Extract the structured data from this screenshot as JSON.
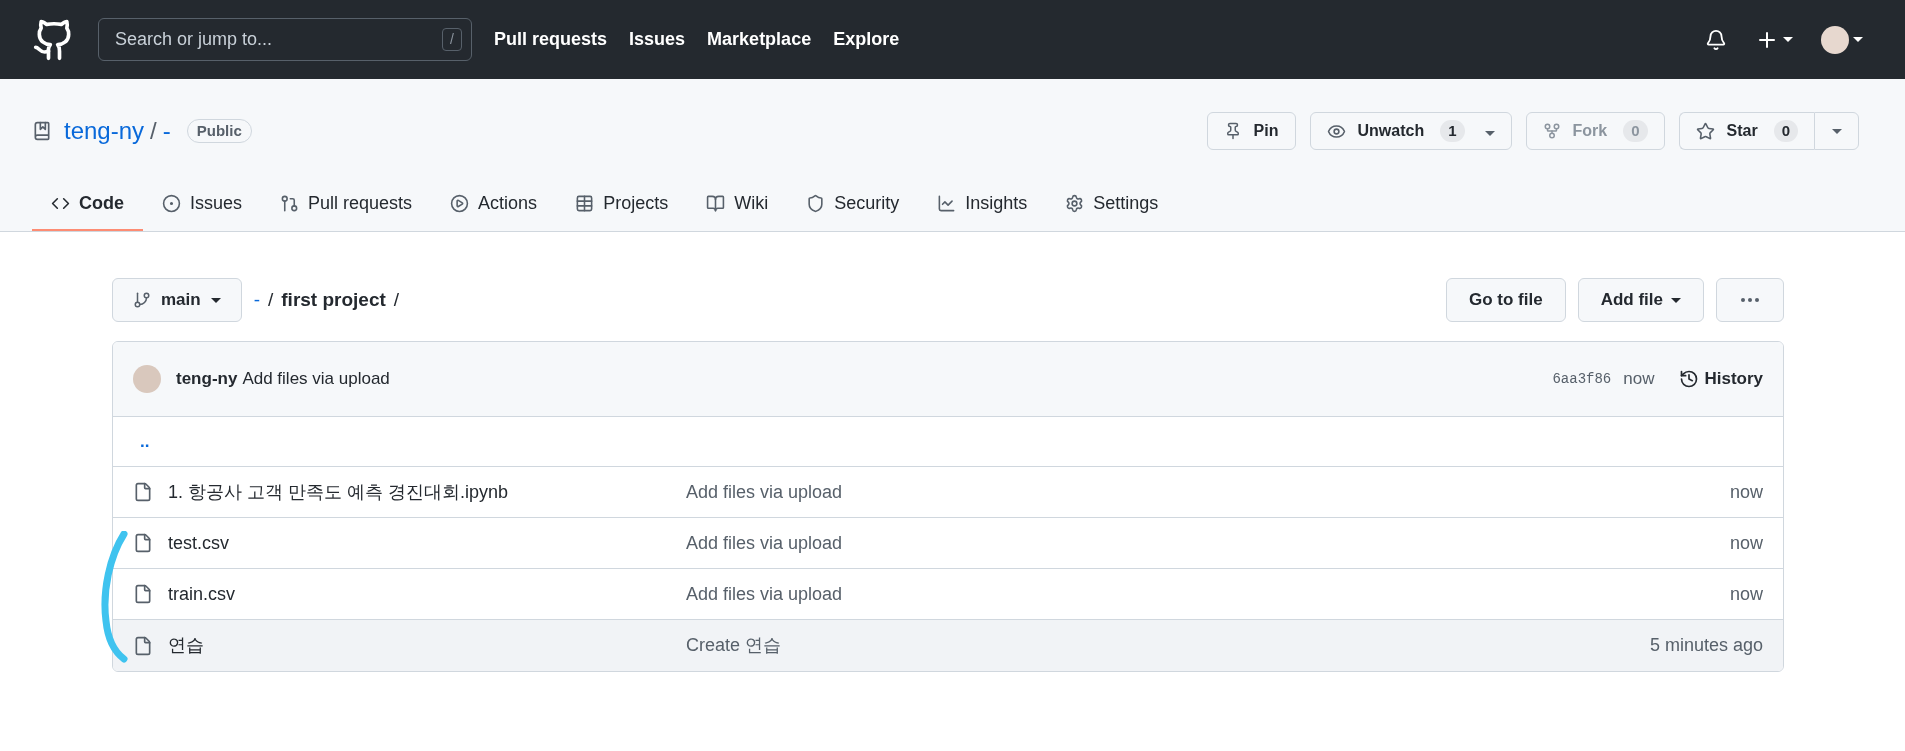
{
  "nav": {
    "search_placeholder": "Search or jump to...",
    "search_key": "/",
    "links": [
      "Pull requests",
      "Issues",
      "Marketplace",
      "Explore"
    ]
  },
  "repo": {
    "owner": "teng-ny",
    "separator": "/",
    "name": "-",
    "visibility": "Public"
  },
  "actions": [
    {
      "kind": "pin",
      "label": "Pin",
      "disabled": false
    },
    {
      "kind": "watch",
      "label": "Unwatch",
      "count": "1",
      "disabled": false
    },
    {
      "kind": "fork",
      "label": "Fork",
      "count": "0",
      "disabled": true
    },
    {
      "kind": "star",
      "label": "Star",
      "count": "0",
      "disabled": false
    }
  ],
  "tabs": [
    {
      "kind": "code",
      "label": "Code",
      "selected": true
    },
    {
      "kind": "issues",
      "label": "Issues",
      "selected": false
    },
    {
      "kind": "pulls",
      "label": "Pull requests",
      "selected": false
    },
    {
      "kind": "actions",
      "label": "Actions",
      "selected": false
    },
    {
      "kind": "projects",
      "label": "Projects",
      "selected": false
    },
    {
      "kind": "wiki",
      "label": "Wiki",
      "selected": false
    },
    {
      "kind": "security",
      "label": "Security",
      "selected": false
    },
    {
      "kind": "insights",
      "label": "Insights",
      "selected": false
    },
    {
      "kind": "settings",
      "label": "Settings",
      "selected": false
    }
  ],
  "branch": "main",
  "path": [
    {
      "kind": "link",
      "text": "-"
    },
    {
      "kind": "sep",
      "text": "/"
    },
    {
      "kind": "current",
      "text": "first project"
    },
    {
      "kind": "sep",
      "text": "/"
    }
  ],
  "file_buttons": [
    "Go to file",
    "Add file"
  ],
  "commit": {
    "author": "teng-ny",
    "message": "Add files via upload",
    "sha": "6aa3f86",
    "time": "now",
    "history": "History"
  },
  "parent_link": "..",
  "files": [
    {
      "name": "1. 항공사 고객 만족도 예측 경진대회.ipynb",
      "message": "Add files via upload",
      "time": "now",
      "highlighted": false
    },
    {
      "name": "test.csv",
      "message": "Add files via upload",
      "time": "now",
      "highlighted": false
    },
    {
      "name": "train.csv",
      "message": "Add files via upload",
      "time": "now",
      "highlighted": false
    },
    {
      "name": "연습",
      "message": "Create 연습",
      "time": "5 minutes ago",
      "highlighted": true
    }
  ]
}
